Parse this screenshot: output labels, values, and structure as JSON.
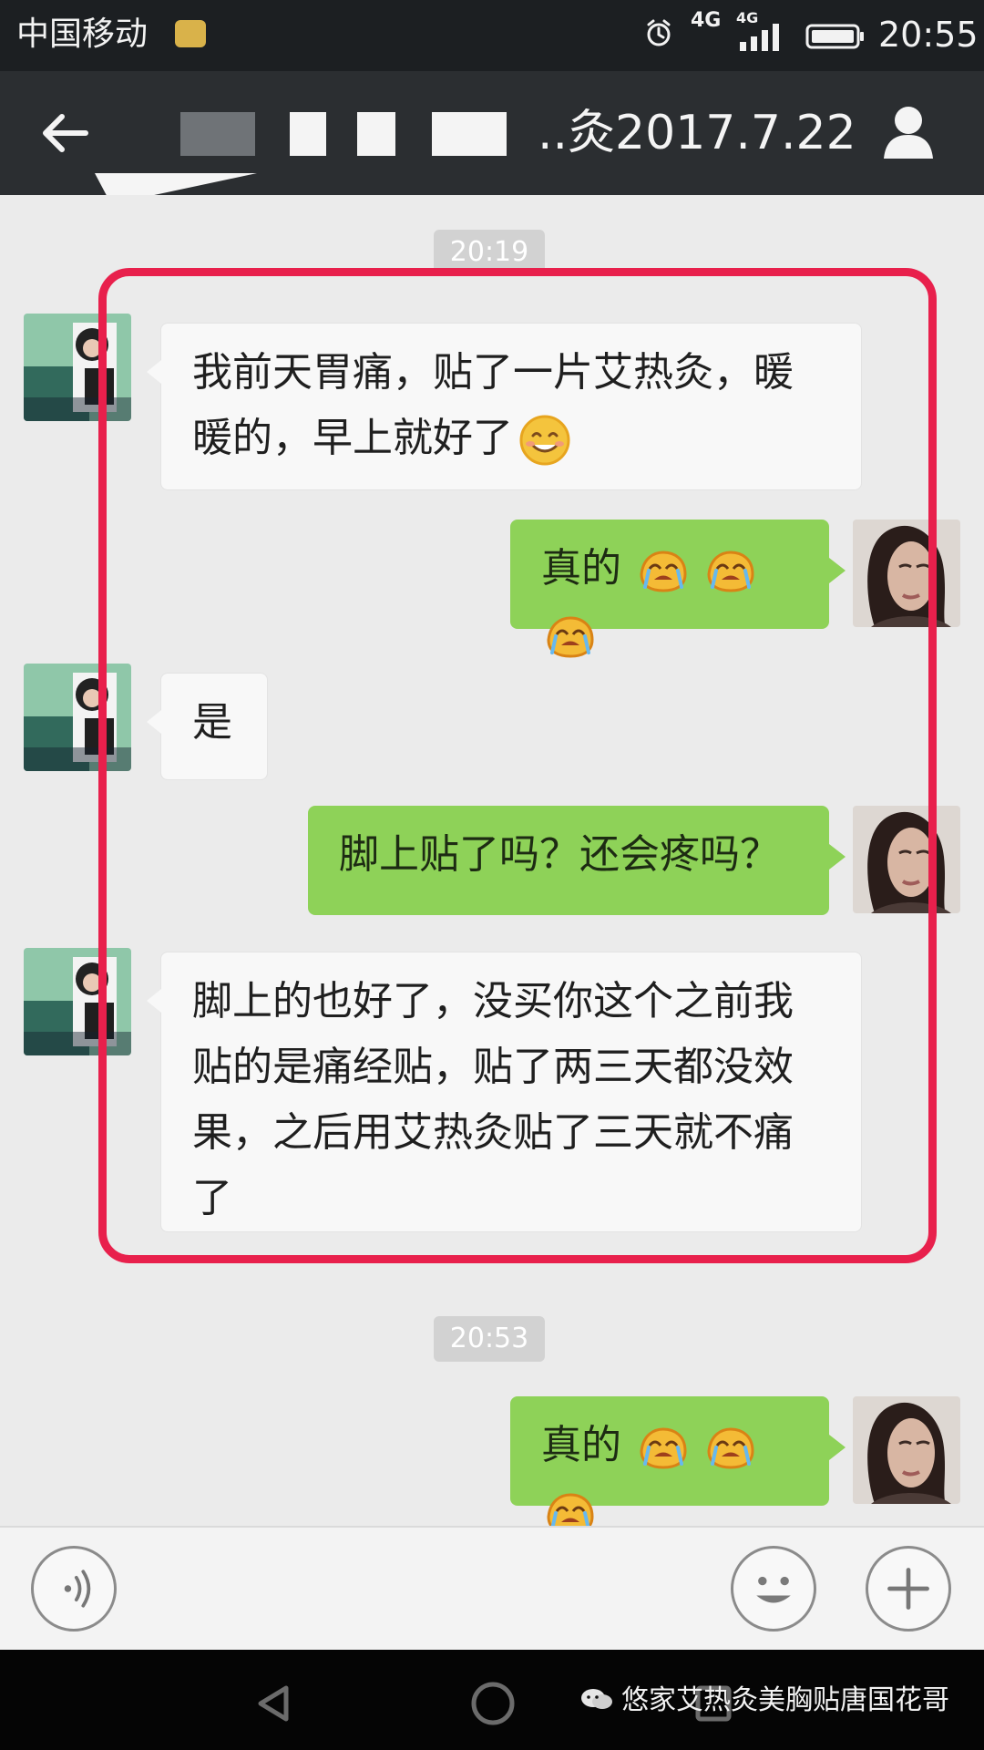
{
  "status_bar": {
    "carrier": "中国移动",
    "network_primary": "4G",
    "network_secondary": "4G",
    "time": "20:55",
    "icons": [
      "sim-badge-icon",
      "alarm-clock-icon",
      "signal-icon",
      "battery-icon"
    ]
  },
  "header": {
    "title_visible": "..灸2017.7.22",
    "back_icon": "back-arrow-icon",
    "profile_icon": "profile-icon"
  },
  "chat": {
    "timestamps": [
      "20:19",
      "20:53"
    ],
    "messages": [
      {
        "side": "incoming",
        "text": "我前天胃痛，贴了一片艾热灸，暖暖的，早上就好了",
        "emoji": "smiling-face-icon"
      },
      {
        "side": "outgoing",
        "text": "真的",
        "emoji": "crying-face-icon"
      },
      {
        "side": "incoming",
        "text": "是"
      },
      {
        "side": "outgoing",
        "text": "脚上贴了吗？还会疼吗？"
      },
      {
        "side": "incoming",
        "text": "脚上的也好了，没买你这个之前我贴的是痛经贴，贴了两三天都没效果，之后用艾热灸贴了三天就不痛了"
      },
      {
        "side": "outgoing",
        "text": "真的",
        "emoji": "crying-face-icon"
      }
    ]
  },
  "input_bar": {
    "voice_icon": "voice-icon",
    "emoji_icon": "emoji-icon",
    "plus_icon": "plus-icon"
  },
  "nav_bar": {
    "back_icon": "nav-back-icon",
    "home_icon": "nav-home-icon",
    "recent_icon": "nav-recent-icon"
  },
  "watermark": {
    "text": "悠家艾热灸美胸贴唐国花哥",
    "icon": "wechat-icon"
  },
  "colors": {
    "highlight": "#e8204c",
    "outgoing_bubble": "#8ed258",
    "incoming_bubble": "#f8f8f8",
    "header": "#2b2e31"
  }
}
